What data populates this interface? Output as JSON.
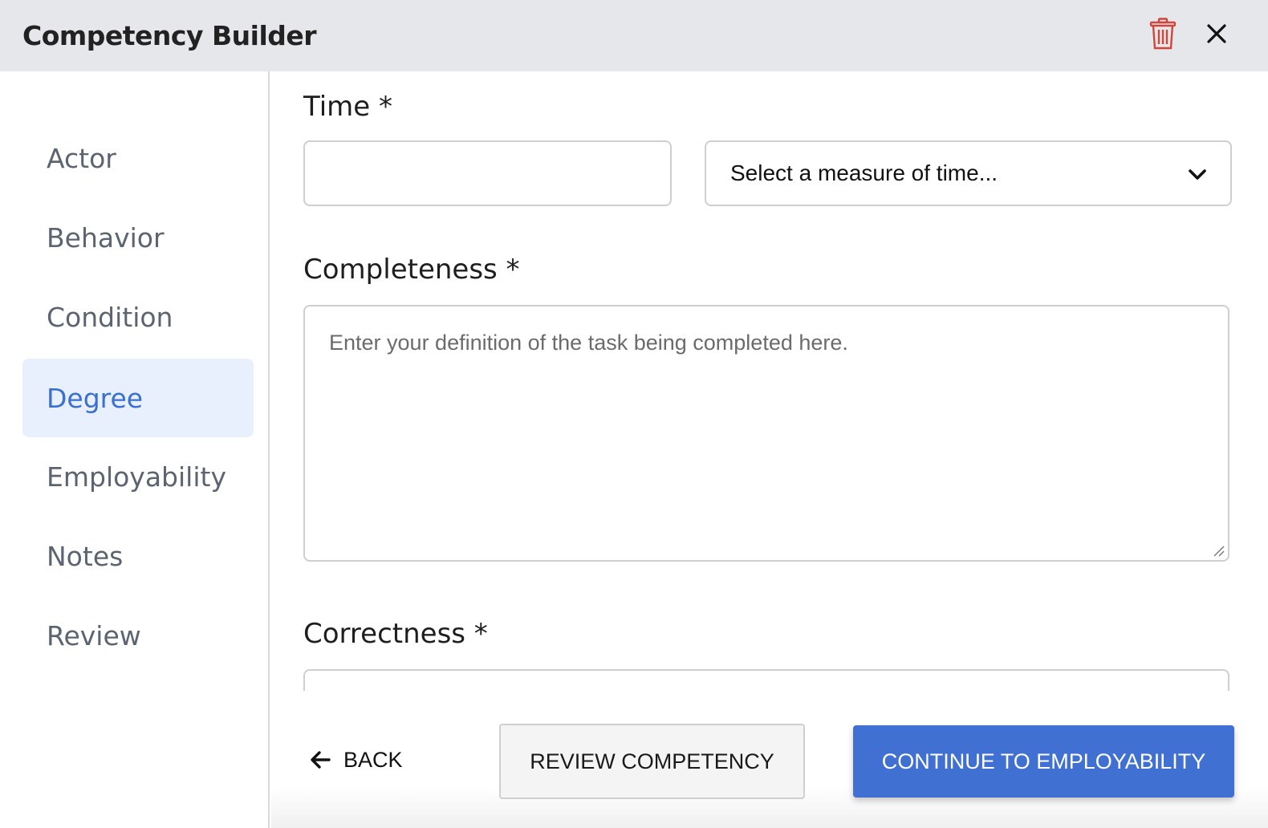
{
  "header": {
    "title": "Competency Builder",
    "icons": {
      "delete": "trash-icon",
      "close": "close-icon"
    },
    "delete_icon_color": "#d0463b"
  },
  "sidebar": {
    "items": [
      {
        "label": "Actor",
        "active": false
      },
      {
        "label": "Behavior",
        "active": false
      },
      {
        "label": "Condition",
        "active": false
      },
      {
        "label": "Degree",
        "active": true
      },
      {
        "label": "Employability",
        "active": false
      },
      {
        "label": "Notes",
        "active": false
      },
      {
        "label": "Review",
        "active": false
      }
    ],
    "active_color": "#3b6fd0",
    "active_bg": "#e8f0fd"
  },
  "form": {
    "time": {
      "label": "Time *",
      "value": "",
      "measure_select": {
        "selected": "Select a measure of time..."
      }
    },
    "completeness": {
      "label": "Completeness *",
      "placeholder": "Enter your definition of the task being completed here.",
      "value": ""
    },
    "correctness": {
      "label": "Correctness *",
      "value": ""
    }
  },
  "footer": {
    "back_label": "BACK",
    "review_label": "REVIEW COMPETENCY",
    "continue_label": "CONTINUE TO EMPLOYABILITY",
    "accent": "#4170d3"
  }
}
